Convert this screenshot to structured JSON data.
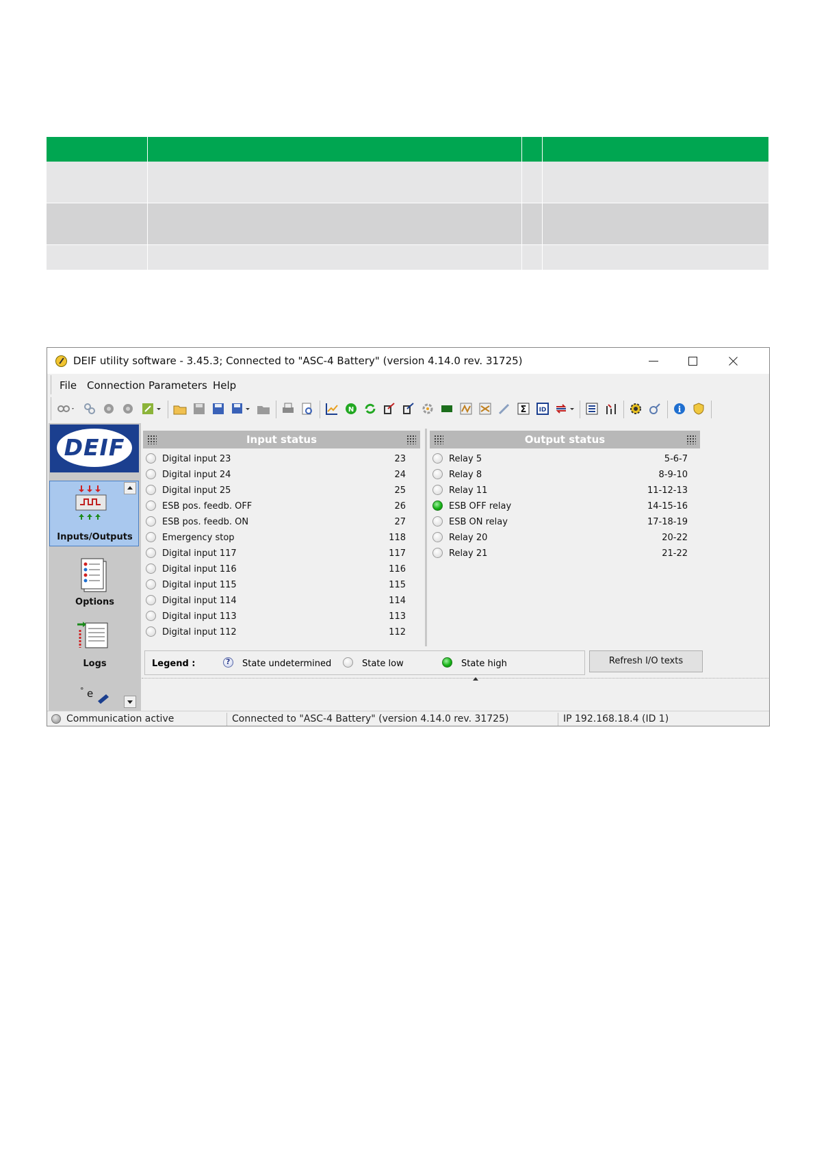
{
  "window": {
    "title": "DEIF utility software - 3.45.3; Connected to \"ASC-4 Battery\" (version 4.14.0 rev. 31725)"
  },
  "menu": [
    "File",
    "Connection",
    "Parameters",
    "Help"
  ],
  "nav": {
    "logo": "DEIF",
    "items": [
      "Inputs/Outputs",
      "Options",
      "Logs"
    ]
  },
  "input_status": {
    "title": "Input status",
    "rows": [
      {
        "label": "Digital input 23",
        "num": "23",
        "state": "low"
      },
      {
        "label": "Digital input 24",
        "num": "24",
        "state": "low"
      },
      {
        "label": "Digital input 25",
        "num": "25",
        "state": "low"
      },
      {
        "label": "ESB pos. feedb. OFF",
        "num": "26",
        "state": "low"
      },
      {
        "label": "ESB pos. feedb. ON",
        "num": "27",
        "state": "low"
      },
      {
        "label": "Emergency stop",
        "num": "118",
        "state": "low"
      },
      {
        "label": "Digital input 117",
        "num": "117",
        "state": "low"
      },
      {
        "label": "Digital input 116",
        "num": "116",
        "state": "low"
      },
      {
        "label": "Digital input 115",
        "num": "115",
        "state": "low"
      },
      {
        "label": "Digital input 114",
        "num": "114",
        "state": "low"
      },
      {
        "label": "Digital input 113",
        "num": "113",
        "state": "low"
      },
      {
        "label": "Digital input 112",
        "num": "112",
        "state": "low"
      }
    ]
  },
  "output_status": {
    "title": "Output status",
    "rows": [
      {
        "label": "Relay 5",
        "num": "5-6-7",
        "state": "low"
      },
      {
        "label": "Relay 8",
        "num": "8-9-10",
        "state": "low"
      },
      {
        "label": "Relay 11",
        "num": "11-12-13",
        "state": "low"
      },
      {
        "label": "ESB OFF relay",
        "num": "14-15-16",
        "state": "high"
      },
      {
        "label": "ESB ON relay",
        "num": "17-18-19",
        "state": "low"
      },
      {
        "label": "Relay 20",
        "num": "20-22",
        "state": "low"
      },
      {
        "label": "Relay 21",
        "num": "21-22",
        "state": "low"
      }
    ]
  },
  "legend": {
    "title": "Legend :",
    "undetermined": "State undetermined",
    "low": "State low",
    "high": "State high"
  },
  "refresh_button": "Refresh I/O texts",
  "status_bar": {
    "communication": "Communication active",
    "connection": "Connected to \"ASC-4 Battery\" (version 4.14.0 rev. 31725)",
    "ip": "IP 192.168.18.4 (ID 1)"
  },
  "colors": {
    "table_header": "#00a651",
    "state_high": "#17b317",
    "nav_selected": "#a9c8ee",
    "logo_blue": "#1b3f8f"
  }
}
